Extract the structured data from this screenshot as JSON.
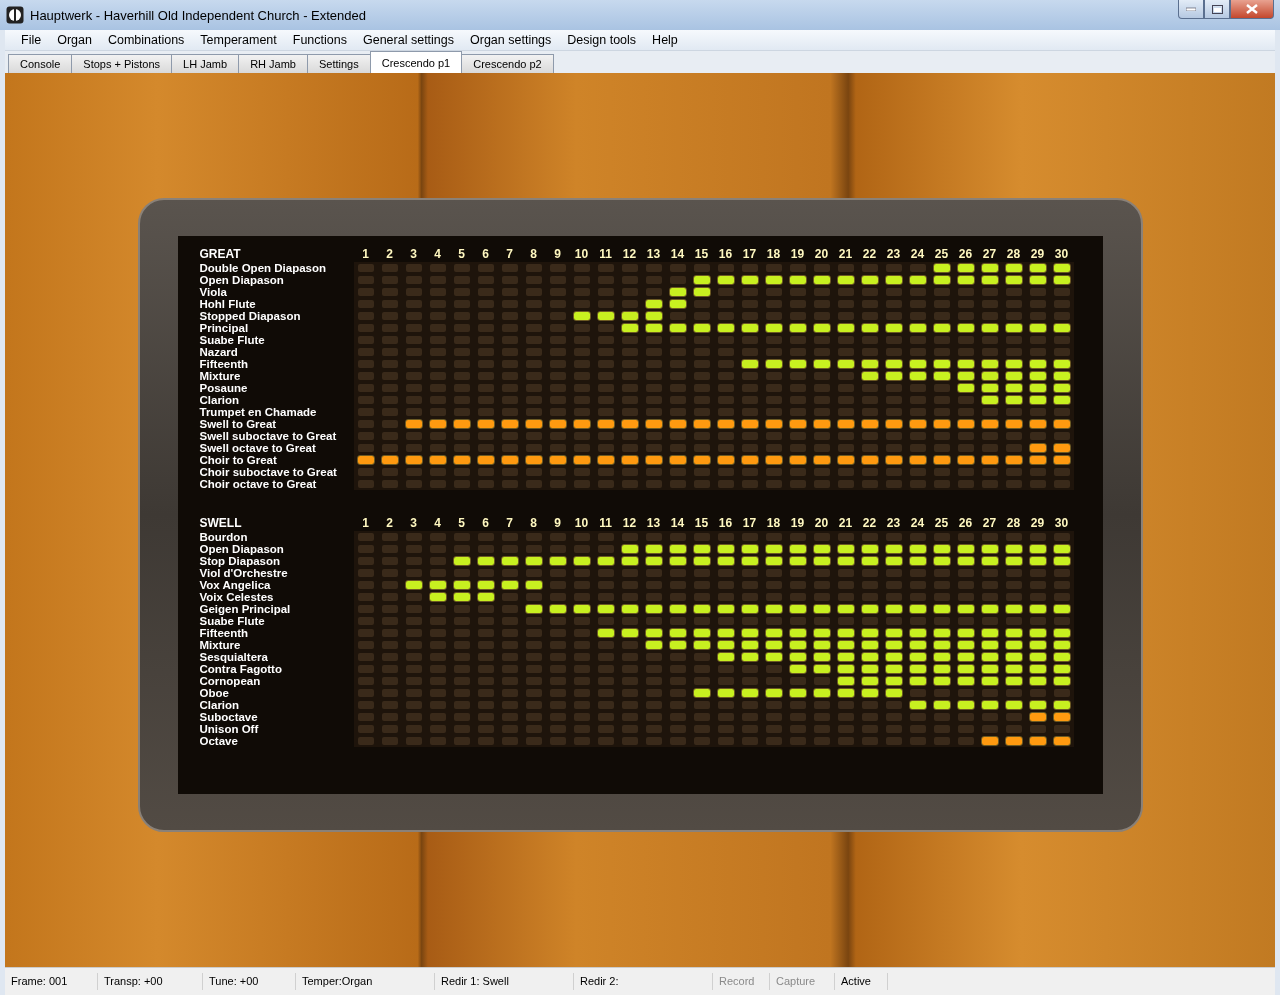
{
  "window": {
    "title": "Hauptwerk - Haverhill Old Independent Church - Extended"
  },
  "menu": [
    "File",
    "Organ",
    "Combinations",
    "Temperament",
    "Functions",
    "General settings",
    "Organ settings",
    "Design tools",
    "Help"
  ],
  "tabs": [
    {
      "label": "Console",
      "selected": false
    },
    {
      "label": "Stops + Pistons",
      "selected": false
    },
    {
      "label": "LH Jamb",
      "selected": false
    },
    {
      "label": "RH Jamb",
      "selected": false
    },
    {
      "label": "Settings",
      "selected": false
    },
    {
      "label": "Crescendo p1",
      "selected": true
    },
    {
      "label": "Crescendo p2",
      "selected": false
    }
  ],
  "sections": [
    {
      "title": "GREAT",
      "columns": [
        "1",
        "2",
        "3",
        "4",
        "5",
        "6",
        "7",
        "8",
        "9",
        "10",
        "11",
        "12",
        "13",
        "14",
        "15",
        "16",
        "17",
        "18",
        "19",
        "20",
        "21",
        "22",
        "23",
        "24",
        "25",
        "26",
        "27",
        "28",
        "29",
        "30"
      ],
      "rows": [
        {
          "name": "Double Open Diapason",
          "color": "#c8f020",
          "lamps": [
            false,
            false,
            false,
            false,
            false,
            false,
            false,
            false,
            false,
            false,
            false,
            false,
            false,
            false,
            false,
            false,
            false,
            false,
            false,
            false,
            false,
            false,
            false,
            false,
            true,
            true,
            true,
            true,
            true,
            true
          ]
        },
        {
          "name": "Open Diapason",
          "color": "#c8f020",
          "lamps": [
            false,
            false,
            false,
            false,
            false,
            false,
            false,
            false,
            false,
            false,
            false,
            false,
            false,
            false,
            true,
            true,
            true,
            true,
            true,
            true,
            true,
            true,
            true,
            true,
            true,
            true,
            true,
            true,
            true,
            true
          ]
        },
        {
          "name": "Viola",
          "color": "#c8f020",
          "lamps": [
            false,
            false,
            false,
            false,
            false,
            false,
            false,
            false,
            false,
            false,
            false,
            false,
            false,
            true,
            true,
            false,
            false,
            false,
            false,
            false,
            false,
            false,
            false,
            false,
            false,
            false,
            false,
            false,
            false,
            false
          ]
        },
        {
          "name": "Hohl Flute",
          "color": "#c8f020",
          "lamps": [
            false,
            false,
            false,
            false,
            false,
            false,
            false,
            false,
            false,
            false,
            false,
            false,
            true,
            true,
            false,
            false,
            false,
            false,
            false,
            false,
            false,
            false,
            false,
            false,
            false,
            false,
            false,
            false,
            false,
            false
          ]
        },
        {
          "name": "Stopped Diapason",
          "color": "#c8f020",
          "lamps": [
            false,
            false,
            false,
            false,
            false,
            false,
            false,
            false,
            false,
            true,
            true,
            true,
            true,
            false,
            false,
            false,
            false,
            false,
            false,
            false,
            false,
            false,
            false,
            false,
            false,
            false,
            false,
            false,
            false,
            false
          ]
        },
        {
          "name": "Principal",
          "color": "#c8f020",
          "lamps": [
            false,
            false,
            false,
            false,
            false,
            false,
            false,
            false,
            false,
            false,
            false,
            true,
            true,
            true,
            true,
            true,
            true,
            true,
            true,
            true,
            true,
            true,
            true,
            true,
            true,
            true,
            true,
            true,
            true,
            true
          ]
        },
        {
          "name": "Suabe Flute",
          "lamps": [
            false,
            false,
            false,
            false,
            false,
            false,
            false,
            false,
            false,
            false,
            false,
            false,
            false,
            false,
            false,
            false,
            false,
            false,
            false,
            false,
            false,
            false,
            false,
            false,
            false,
            false,
            false,
            false,
            false,
            false
          ]
        },
        {
          "name": "Nazard",
          "lamps": [
            false,
            false,
            false,
            false,
            false,
            false,
            false,
            false,
            false,
            false,
            false,
            false,
            false,
            false,
            false,
            false,
            false,
            false,
            false,
            false,
            false,
            false,
            false,
            false,
            false,
            false,
            false,
            false,
            false,
            false
          ]
        },
        {
          "name": "Fifteenth",
          "color": "#c8f020",
          "lamps": [
            false,
            false,
            false,
            false,
            false,
            false,
            false,
            false,
            false,
            false,
            false,
            false,
            false,
            false,
            false,
            false,
            true,
            true,
            true,
            true,
            true,
            true,
            true,
            true,
            true,
            true,
            true,
            true,
            true,
            true
          ]
        },
        {
          "name": "Mixture",
          "color": "#c8f020",
          "lamps": [
            false,
            false,
            false,
            false,
            false,
            false,
            false,
            false,
            false,
            false,
            false,
            false,
            false,
            false,
            false,
            false,
            false,
            false,
            false,
            false,
            false,
            true,
            true,
            true,
            true,
            true,
            true,
            true,
            true,
            true
          ]
        },
        {
          "name": "Posaune",
          "color": "#c8f020",
          "lamps": [
            false,
            false,
            false,
            false,
            false,
            false,
            false,
            false,
            false,
            false,
            false,
            false,
            false,
            false,
            false,
            false,
            false,
            false,
            false,
            false,
            false,
            false,
            false,
            false,
            false,
            true,
            true,
            true,
            true,
            true
          ]
        },
        {
          "name": "Clarion",
          "color": "#c8f020",
          "lamps": [
            false,
            false,
            false,
            false,
            false,
            false,
            false,
            false,
            false,
            false,
            false,
            false,
            false,
            false,
            false,
            false,
            false,
            false,
            false,
            false,
            false,
            false,
            false,
            false,
            false,
            false,
            true,
            true,
            true,
            true
          ]
        },
        {
          "name": "Trumpet en Chamade",
          "lamps": [
            false,
            false,
            false,
            false,
            false,
            false,
            false,
            false,
            false,
            false,
            false,
            false,
            false,
            false,
            false,
            false,
            false,
            false,
            false,
            false,
            false,
            false,
            false,
            false,
            false,
            false,
            false,
            false,
            false,
            false
          ]
        },
        {
          "name": "Swell to Great",
          "color": "#ff9a10",
          "lamps": [
            false,
            false,
            true,
            true,
            true,
            true,
            true,
            true,
            true,
            true,
            true,
            true,
            true,
            true,
            true,
            true,
            true,
            true,
            true,
            true,
            true,
            true,
            true,
            true,
            true,
            true,
            true,
            true,
            true,
            true
          ]
        },
        {
          "name": "Swell suboctave to Great",
          "lamps": [
            false,
            false,
            false,
            false,
            false,
            false,
            false,
            false,
            false,
            false,
            false,
            false,
            false,
            false,
            false,
            false,
            false,
            false,
            false,
            false,
            false,
            false,
            false,
            false,
            false,
            false,
            false,
            false,
            false,
            false
          ]
        },
        {
          "name": "Swell octave to Great",
          "color": "#ff9a10",
          "lamps": [
            false,
            false,
            false,
            false,
            false,
            false,
            false,
            false,
            false,
            false,
            false,
            false,
            false,
            false,
            false,
            false,
            false,
            false,
            false,
            false,
            false,
            false,
            false,
            false,
            false,
            false,
            false,
            false,
            true,
            true
          ]
        },
        {
          "name": "Choir to Great",
          "color": "#ff9a10",
          "lamps": [
            true,
            true,
            true,
            true,
            true,
            true,
            true,
            true,
            true,
            true,
            true,
            true,
            true,
            true,
            true,
            true,
            true,
            true,
            true,
            true,
            true,
            true,
            true,
            true,
            true,
            true,
            true,
            true,
            true,
            true
          ]
        },
        {
          "name": "Choir suboctave to Great",
          "lamps": [
            false,
            false,
            false,
            false,
            false,
            false,
            false,
            false,
            false,
            false,
            false,
            false,
            false,
            false,
            false,
            false,
            false,
            false,
            false,
            false,
            false,
            false,
            false,
            false,
            false,
            false,
            false,
            false,
            false,
            false
          ]
        },
        {
          "name": "Choir octave to Great",
          "lamps": [
            false,
            false,
            false,
            false,
            false,
            false,
            false,
            false,
            false,
            false,
            false,
            false,
            false,
            false,
            false,
            false,
            false,
            false,
            false,
            false,
            false,
            false,
            false,
            false,
            false,
            false,
            false,
            false,
            false,
            false
          ]
        }
      ]
    },
    {
      "title": "SWELL",
      "columns": [
        "1",
        "2",
        "3",
        "4",
        "5",
        "6",
        "7",
        "8",
        "9",
        "10",
        "11",
        "12",
        "13",
        "14",
        "15",
        "16",
        "17",
        "18",
        "19",
        "20",
        "21",
        "22",
        "23",
        "24",
        "25",
        "26",
        "27",
        "28",
        "29",
        "30"
      ],
      "rows": [
        {
          "name": "Bourdon",
          "lamps": [
            false,
            false,
            false,
            false,
            false,
            false,
            false,
            false,
            false,
            false,
            false,
            false,
            false,
            false,
            false,
            false,
            false,
            false,
            false,
            false,
            false,
            false,
            false,
            false,
            false,
            false,
            false,
            false,
            false,
            false
          ]
        },
        {
          "name": "Open Diapason",
          "color": "#c8f020",
          "lamps": [
            false,
            false,
            false,
            false,
            false,
            false,
            false,
            false,
            false,
            false,
            false,
            true,
            true,
            true,
            true,
            true,
            true,
            true,
            true,
            true,
            true,
            true,
            true,
            true,
            true,
            true,
            true,
            true,
            true,
            true
          ]
        },
        {
          "name": "Stop Diapason",
          "color": "#c8f020",
          "lamps": [
            false,
            false,
            false,
            false,
            true,
            true,
            true,
            true,
            true,
            true,
            true,
            true,
            true,
            true,
            true,
            true,
            true,
            true,
            true,
            true,
            true,
            true,
            true,
            true,
            true,
            true,
            true,
            true,
            true,
            true
          ]
        },
        {
          "name": "Viol d'Orchestre",
          "lamps": [
            false,
            false,
            false,
            false,
            false,
            false,
            false,
            false,
            false,
            false,
            false,
            false,
            false,
            false,
            false,
            false,
            false,
            false,
            false,
            false,
            false,
            false,
            false,
            false,
            false,
            false,
            false,
            false,
            false,
            false
          ]
        },
        {
          "name": "Vox Angelica",
          "color": "#c8f020",
          "lamps": [
            false,
            false,
            true,
            true,
            true,
            true,
            true,
            true,
            false,
            false,
            false,
            false,
            false,
            false,
            false,
            false,
            false,
            false,
            false,
            false,
            false,
            false,
            false,
            false,
            false,
            false,
            false,
            false,
            false,
            false
          ]
        },
        {
          "name": "Voix Celestes",
          "color": "#c8f020",
          "lamps": [
            false,
            false,
            false,
            true,
            true,
            true,
            false,
            false,
            false,
            false,
            false,
            false,
            false,
            false,
            false,
            false,
            false,
            false,
            false,
            false,
            false,
            false,
            false,
            false,
            false,
            false,
            false,
            false,
            false,
            false
          ]
        },
        {
          "name": "Geigen Principal",
          "color": "#c8f020",
          "lamps": [
            false,
            false,
            false,
            false,
            false,
            false,
            false,
            true,
            true,
            true,
            true,
            true,
            true,
            true,
            true,
            true,
            true,
            true,
            true,
            true,
            true,
            true,
            true,
            true,
            true,
            true,
            true,
            true,
            true,
            true
          ]
        },
        {
          "name": "Suabe Flute",
          "lamps": [
            false,
            false,
            false,
            false,
            false,
            false,
            false,
            false,
            false,
            false,
            false,
            false,
            false,
            false,
            false,
            false,
            false,
            false,
            false,
            false,
            false,
            false,
            false,
            false,
            false,
            false,
            false,
            false,
            false,
            false
          ]
        },
        {
          "name": "Fifteenth",
          "color": "#c8f020",
          "lamps": [
            false,
            false,
            false,
            false,
            false,
            false,
            false,
            false,
            false,
            false,
            true,
            true,
            true,
            true,
            true,
            true,
            true,
            true,
            true,
            true,
            true,
            true,
            true,
            true,
            true,
            true,
            true,
            true,
            true,
            true
          ]
        },
        {
          "name": "Mixture",
          "color": "#c8f020",
          "lamps": [
            false,
            false,
            false,
            false,
            false,
            false,
            false,
            false,
            false,
            false,
            false,
            false,
            true,
            true,
            true,
            true,
            true,
            true,
            true,
            true,
            true,
            true,
            true,
            true,
            true,
            true,
            true,
            true,
            true,
            true
          ]
        },
        {
          "name": "Sesquialtera",
          "color": "#c8f020",
          "lamps": [
            false,
            false,
            false,
            false,
            false,
            false,
            false,
            false,
            false,
            false,
            false,
            false,
            false,
            false,
            false,
            true,
            true,
            true,
            true,
            true,
            true,
            true,
            true,
            true,
            true,
            true,
            true,
            true,
            true,
            true
          ]
        },
        {
          "name": "Contra Fagotto",
          "color": "#c8f020",
          "lamps": [
            false,
            false,
            false,
            false,
            false,
            false,
            false,
            false,
            false,
            false,
            false,
            false,
            false,
            false,
            false,
            false,
            false,
            false,
            true,
            true,
            true,
            true,
            true,
            true,
            true,
            true,
            true,
            true,
            true,
            true
          ]
        },
        {
          "name": "Cornopean",
          "color": "#c8f020",
          "lamps": [
            false,
            false,
            false,
            false,
            false,
            false,
            false,
            false,
            false,
            false,
            false,
            false,
            false,
            false,
            false,
            false,
            false,
            false,
            false,
            false,
            true,
            true,
            true,
            true,
            true,
            true,
            true,
            true,
            true,
            true
          ]
        },
        {
          "name": "Oboe",
          "color": "#c8f020",
          "lamps": [
            false,
            false,
            false,
            false,
            false,
            false,
            false,
            false,
            false,
            false,
            false,
            false,
            false,
            false,
            true,
            true,
            true,
            true,
            true,
            true,
            true,
            true,
            true,
            false,
            false,
            false,
            false,
            false,
            false,
            false
          ]
        },
        {
          "name": "Clarion",
          "color": "#c8f020",
          "lamps": [
            false,
            false,
            false,
            false,
            false,
            false,
            false,
            false,
            false,
            false,
            false,
            false,
            false,
            false,
            false,
            false,
            false,
            false,
            false,
            false,
            false,
            false,
            false,
            true,
            true,
            true,
            true,
            true,
            true,
            true
          ]
        },
        {
          "name": "Suboctave",
          "color": "#ff9a10",
          "lamps": [
            false,
            false,
            false,
            false,
            false,
            false,
            false,
            false,
            false,
            false,
            false,
            false,
            false,
            false,
            false,
            false,
            false,
            false,
            false,
            false,
            false,
            false,
            false,
            false,
            false,
            false,
            false,
            false,
            true,
            true
          ]
        },
        {
          "name": "Unison Off",
          "lamps": [
            false,
            false,
            false,
            false,
            false,
            false,
            false,
            false,
            false,
            false,
            false,
            false,
            false,
            false,
            false,
            false,
            false,
            false,
            false,
            false,
            false,
            false,
            false,
            false,
            false,
            false,
            false,
            false,
            false,
            false
          ]
        },
        {
          "name": "Octave",
          "color": "#ff9a10",
          "lamps": [
            false,
            false,
            false,
            false,
            false,
            false,
            false,
            false,
            false,
            false,
            false,
            false,
            false,
            false,
            false,
            false,
            false,
            false,
            false,
            false,
            false,
            false,
            false,
            false,
            false,
            false,
            true,
            true,
            true,
            true
          ]
        }
      ]
    }
  ],
  "status_bar": [
    {
      "text": "Frame: 001",
      "disabled": false
    },
    {
      "text": "Transp: +00",
      "disabled": false
    },
    {
      "text": "Tune: +00",
      "disabled": false
    },
    {
      "text": "Temper:Organ",
      "disabled": false
    },
    {
      "text": "Redir 1: Swell",
      "disabled": false
    },
    {
      "text": "Redir 2:",
      "disabled": false
    },
    {
      "text": "Record",
      "disabled": true
    },
    {
      "text": "Capture",
      "disabled": true
    },
    {
      "text": "Active",
      "disabled": false
    }
  ]
}
